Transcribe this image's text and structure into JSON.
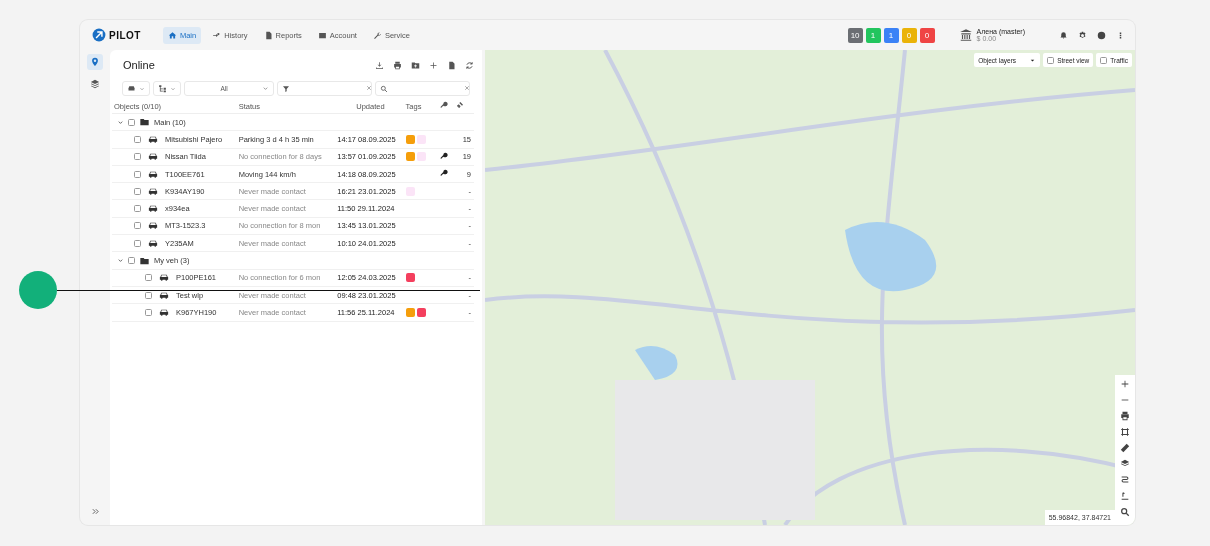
{
  "logo": {
    "text": "PILOT"
  },
  "nav": [
    {
      "label": "Main",
      "selected": true
    },
    {
      "label": "History",
      "selected": false
    },
    {
      "label": "Reports",
      "selected": false
    },
    {
      "label": "Account",
      "selected": false
    },
    {
      "label": "Service",
      "selected": false
    }
  ],
  "counters": [
    {
      "value": "10",
      "color": "#6b6e73"
    },
    {
      "value": "1",
      "color": "#22c55e"
    },
    {
      "value": "1",
      "color": "#3b82f6"
    },
    {
      "value": "0",
      "color": "#eab308"
    },
    {
      "value": "0",
      "color": "#ef4444"
    }
  ],
  "user": {
    "name": "Алена (master)",
    "balance": "$ 0.00"
  },
  "rail": [
    {
      "selected": true
    },
    {
      "selected": false
    }
  ],
  "panel": {
    "title": "Online",
    "type_filter": "All"
  },
  "table": {
    "columns": [
      "Objects (0/10)",
      "Status",
      "Updated",
      "Tags"
    ],
    "groups": [
      {
        "name": "Main (10)",
        "expanded": true,
        "checked": false,
        "rows": [
          {
            "name": "Mitsubishi Pajero",
            "status": "Parking 3 d 4 h 35 min",
            "dim": false,
            "updated": "14:17 08.09.2025",
            "tags": [
              {
                "color": "#f59e0b"
              },
              {
                "color": "#fbe4f7"
              }
            ],
            "key": false,
            "count": "15",
            "checked": false
          },
          {
            "name": "Nissan Tiida",
            "status": "No connection for 8 days",
            "dim": true,
            "updated": "13:57 01.09.2025",
            "tags": [
              {
                "color": "#f59e0b"
              },
              {
                "color": "#fbe4f7"
              }
            ],
            "key": true,
            "count": "19",
            "checked": false
          },
          {
            "name": "T100EE761",
            "status": "Moving 144 km/h",
            "dim": false,
            "updated": "14:18 08.09.2025",
            "tags": [],
            "key": true,
            "count": "9",
            "checked": false
          },
          {
            "name": "K934AY190",
            "status": "Never made contact",
            "dim": true,
            "updated": "16:21 23.01.2025",
            "tags": [
              {
                "color": "#fbe4f7"
              }
            ],
            "key": false,
            "count": "-",
            "checked": false
          },
          {
            "name": "x934ea",
            "status": "Never made contact",
            "dim": true,
            "updated": "11:50 29.11.2024",
            "tags": [],
            "key": false,
            "count": "-",
            "checked": false
          },
          {
            "name": "MT3-1523.3",
            "status": "No connection for 8 mon",
            "dim": true,
            "updated": "13:45 13.01.2025",
            "tags": [],
            "key": false,
            "count": "-",
            "checked": false
          },
          {
            "name": "Y235AM",
            "status": "Never made contact",
            "dim": true,
            "updated": "10:10 24.01.2025",
            "tags": [],
            "key": false,
            "count": "-",
            "checked": false
          }
        ]
      },
      {
        "name": "My veh (3)",
        "expanded": true,
        "checked": false,
        "rows": [
          {
            "name": "P100PE161",
            "status": "No connection for 6 mon",
            "dim": true,
            "updated": "12:05 24.03.2025",
            "tags": [
              {
                "color": "#f43f5e"
              }
            ],
            "key": false,
            "count": "-",
            "checked": false
          },
          {
            "name": "Test wlp",
            "status": "Never made contact",
            "dim": true,
            "updated": "09:48 23.01.2025",
            "tags": [],
            "key": false,
            "count": "-",
            "checked": false
          },
          {
            "name": "K967YH190",
            "status": "Never made contact",
            "dim": true,
            "updated": "11:56 25.11.2024",
            "tags": [
              {
                "color": "#f59e0b"
              },
              {
                "color": "#f43f5e"
              }
            ],
            "key": false,
            "count": "-",
            "checked": false
          }
        ]
      }
    ]
  },
  "map": {
    "layers": "Object layers",
    "street_view": {
      "label": "Street view",
      "checked": false
    },
    "traffic": {
      "label": "Traffic",
      "checked": false
    },
    "coordinates": "55.96842, 37.84721"
  }
}
